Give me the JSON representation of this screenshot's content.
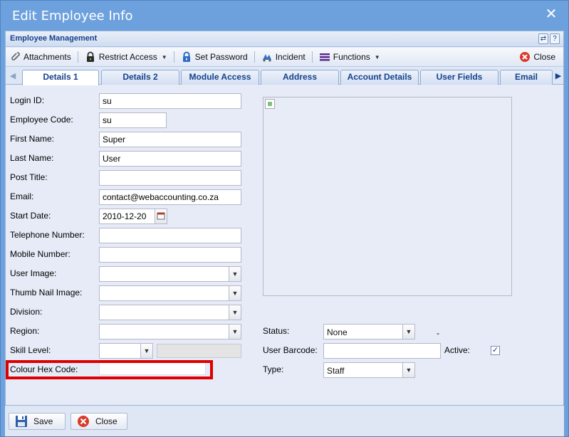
{
  "window": {
    "title": "Edit Employee Info",
    "close_symbol": "✕"
  },
  "panel": {
    "title": "Employee Management",
    "tool_refresh": "⇄",
    "tool_help": "?"
  },
  "toolbar": {
    "attachments": "Attachments",
    "restrict_access": "Restrict Access",
    "set_password": "Set Password",
    "incident": "Incident",
    "functions": "Functions",
    "close": "Close"
  },
  "tabs": [
    "Details 1",
    "Details 2",
    "Module Access",
    "Address",
    "Account Details",
    "User Fields",
    "Email"
  ],
  "form": {
    "login_id": {
      "label": "Login ID:",
      "value": "su"
    },
    "employee_code": {
      "label": "Employee Code:",
      "value": "su"
    },
    "first_name": {
      "label": "First Name:",
      "value": "Super"
    },
    "last_name": {
      "label": "Last Name:",
      "value": "User"
    },
    "post_title": {
      "label": "Post Title:",
      "value": ""
    },
    "email": {
      "label": "Email:",
      "value": "contact@webaccounting.co.za"
    },
    "start_date": {
      "label": "Start Date:",
      "value": "2010-12-20"
    },
    "telephone": {
      "label": "Telephone Number:",
      "value": ""
    },
    "mobile": {
      "label": "Mobile Number:",
      "value": ""
    },
    "user_image": {
      "label": "User Image:",
      "value": ""
    },
    "thumb_image": {
      "label": "Thumb Nail Image:",
      "value": ""
    },
    "division": {
      "label": "Division:",
      "value": ""
    },
    "region": {
      "label": "Region:",
      "value": ""
    },
    "skill_level": {
      "label": "Skill Level:",
      "value": ""
    },
    "colour_hex": {
      "label": "Colour Hex Code:",
      "value": ""
    },
    "status": {
      "label": "Status:",
      "value": "None",
      "suffix": "-"
    },
    "user_barcode": {
      "label": "User Barcode:",
      "value": ""
    },
    "active": {
      "label": "Active:",
      "checked": true
    },
    "type": {
      "label": "Type:",
      "value": "Staff"
    }
  },
  "footer": {
    "save": "Save",
    "close": "Close"
  },
  "colors": {
    "highlight": "#dd0000",
    "title_bg": "#6da1dd",
    "panel_title": "#15428b"
  }
}
